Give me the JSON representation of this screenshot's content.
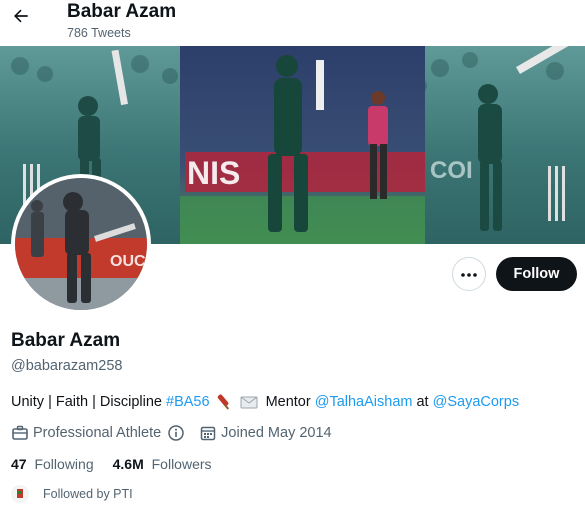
{
  "header": {
    "title": "Babar Azam",
    "tweet_count": "786 Tweets"
  },
  "actions": {
    "follow_label": "Follow"
  },
  "profile": {
    "name": "Babar Azam",
    "handle": "@babarazam258",
    "bio": {
      "text1": "Unity | Faith | Discipline ",
      "hashtag": "#BA56",
      "text2": " Mentor ",
      "mention1": "@TalhaAisham",
      "text3": " at ",
      "mention2": "@SayaCorps"
    },
    "category": "Professional Athlete",
    "joined": "Joined May 2014",
    "following_count": "47",
    "following_label": "Following",
    "followers_count": "4.6M",
    "followers_label": "Followers",
    "followed_by": "Followed by PTI"
  },
  "colors": {
    "link": "#1d9bf0",
    "follow_button": "#0f1419",
    "banner_tint": "#3f7c7c",
    "secondary_text": "#536471"
  },
  "icons": [
    "back-arrow-icon",
    "more-icon",
    "briefcase-icon",
    "info-icon",
    "calendar-icon",
    "cricket-bat-emoji",
    "envelope-emoji"
  ]
}
